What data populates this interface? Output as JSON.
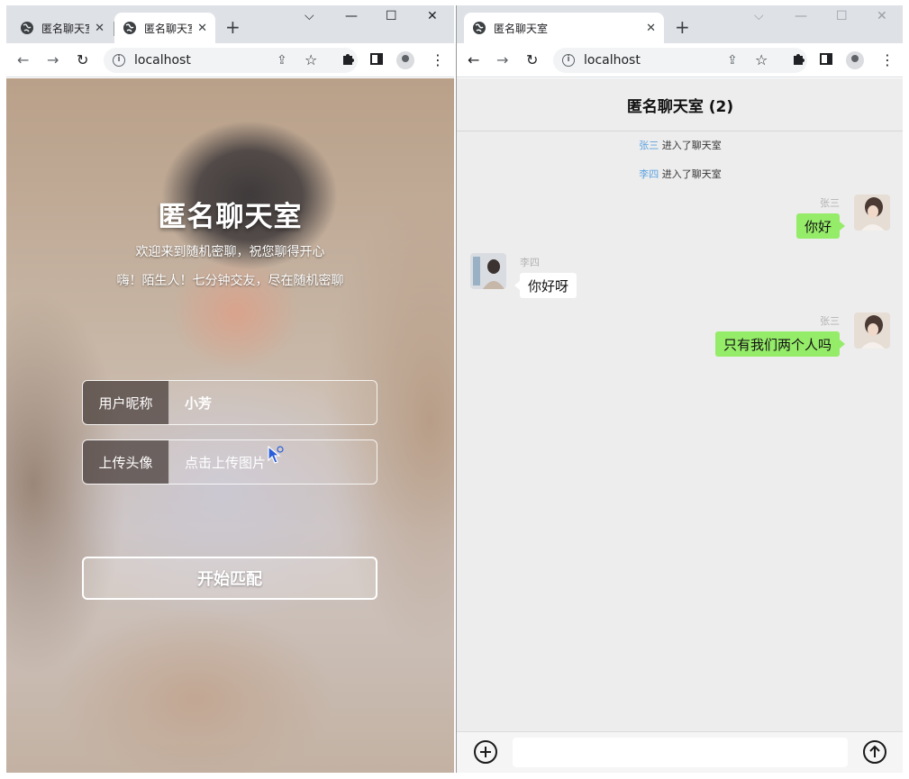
{
  "left_window": {
    "tabs": [
      {
        "title": "匿名聊天室",
        "close": "✕"
      },
      {
        "title": "匿名聊天室",
        "close": "✕"
      }
    ],
    "new_tab": "+",
    "controls": {
      "dropdown": "⌵",
      "minimize": "—",
      "maximize": "☐",
      "close": "✕"
    },
    "url": "localhost",
    "login": {
      "title": "匿名聊天室",
      "subtitle1": "欢迎来到随机密聊，祝您聊得开心",
      "subtitle2": "嗨！陌生人！七分钟交友，尽在随机密聊",
      "nickname_label": "用户昵称",
      "nickname_value": "小芳",
      "avatar_label": "上传头像",
      "avatar_placeholder": "点击上传图片",
      "start_button": "开始匹配"
    }
  },
  "right_window": {
    "tab": {
      "title": "匿名聊天室",
      "close": "✕"
    },
    "new_tab": "+",
    "controls": {
      "dropdown": "⌵",
      "minimize": "—",
      "maximize": "☐",
      "close": "✕"
    },
    "url": "localhost",
    "chat": {
      "header": "匿名聊天室 (2)",
      "system_messages": [
        {
          "user": "张三",
          "text": "进入了聊天室"
        },
        {
          "user": "李四",
          "text": "进入了聊天室"
        }
      ],
      "messages": [
        {
          "sender": "张三",
          "text": "你好",
          "side": "right"
        },
        {
          "sender": "李四",
          "text": "你好呀",
          "side": "left"
        },
        {
          "sender": "张三",
          "text": "只有我们两个人吗",
          "side": "right"
        }
      ],
      "input_value": ""
    }
  },
  "colors": {
    "my_bubble": "#95ec69",
    "other_bubble": "#ffffff",
    "system_name": "#5aa2e0",
    "chat_background": "#ededed"
  }
}
